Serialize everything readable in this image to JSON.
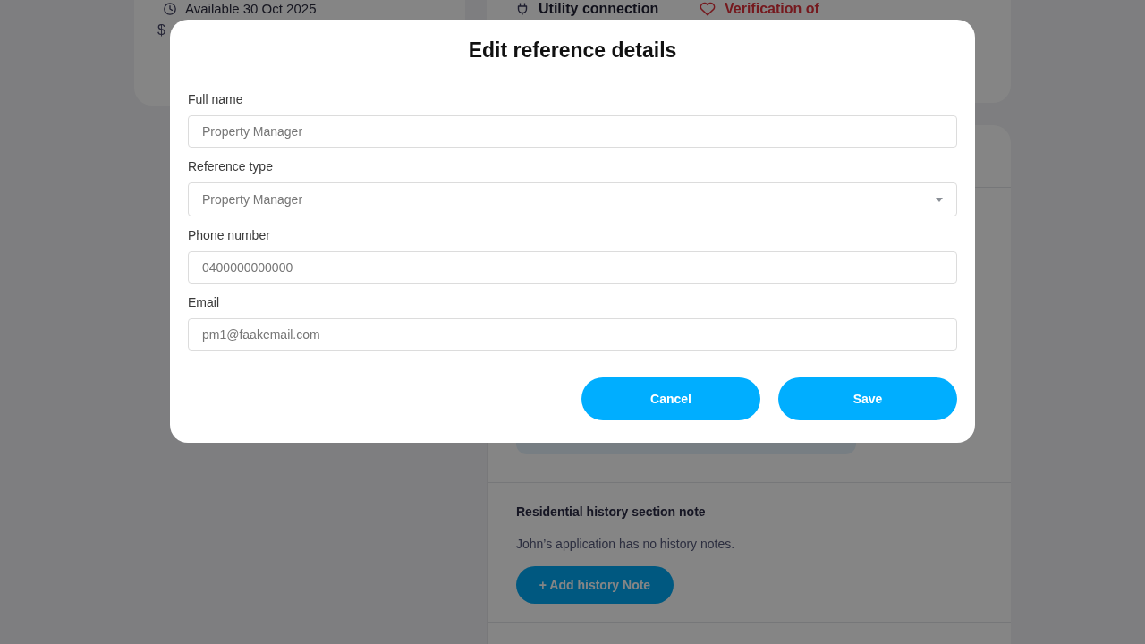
{
  "background": {
    "availability_card": {
      "items": [
        {
          "kind": "date",
          "text": "Available 30 Oct 2025"
        },
        {
          "kind": "price",
          "text": "$"
        }
      ]
    },
    "summary_card": {
      "items": [
        {
          "kind": "utility",
          "text": "Utility connection"
        },
        {
          "kind": "verification",
          "text": "Verification of"
        }
      ]
    },
    "history_note": {
      "title": "Residential history section note",
      "text": "John’s application has no history notes.",
      "button": "+ Add history Note"
    }
  },
  "dialog": {
    "title": "Edit reference details",
    "fields": [
      {
        "label": "Full name",
        "kind": "text",
        "value": "Property Manager"
      },
      {
        "label": "Reference type",
        "kind": "select",
        "value": "Property Manager"
      },
      {
        "label": "Phone number",
        "kind": "text",
        "value": "0400000000000"
      },
      {
        "label": "Email",
        "kind": "text",
        "value": "pm1@faakemail.com"
      }
    ],
    "buttons": [
      {
        "label": "Cancel"
      },
      {
        "label": "Save"
      }
    ]
  }
}
